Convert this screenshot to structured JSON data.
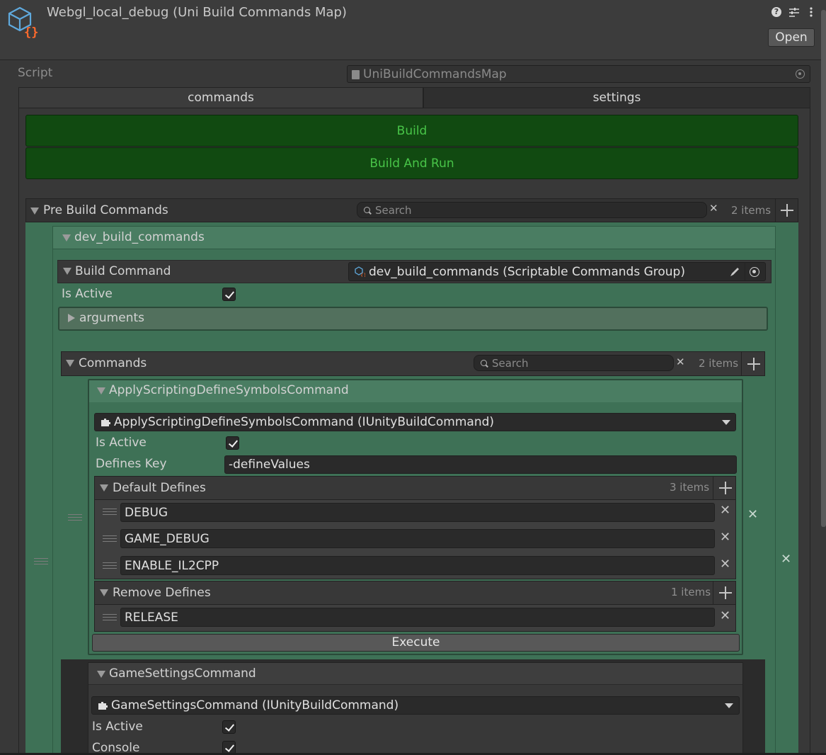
{
  "header": {
    "title": "Webgl_local_debug (Uni Build Commands Map)",
    "open_label": "Open",
    "help_icon": "question-circle-icon",
    "preset_icon": "sliders-icon",
    "menu_icon": "vertical-dots-icon"
  },
  "script_row": {
    "label": "Script",
    "value": "UniBuildCommandsMap"
  },
  "tabs": [
    {
      "label": "commands",
      "active": true
    },
    {
      "label": "settings",
      "active": false
    }
  ],
  "buttons": {
    "build": "Build",
    "build_and_run": "Build And Run"
  },
  "pre_build": {
    "label": "Pre Build Commands",
    "search_placeholder": "Search",
    "count": "2 items",
    "group": {
      "name": "dev_build_commands",
      "build_command_label": "Build Command",
      "build_command_value": "dev_build_commands (Scriptable Commands Group)",
      "is_active_label": "Is Active",
      "is_active": true,
      "arguments_label": "arguments",
      "commands": {
        "label": "Commands",
        "search_placeholder": "Search",
        "count": "2 items",
        "items": [
          {
            "name": "ApplyScriptingDefineSymbolsCommand",
            "type_value": "ApplyScriptingDefineSymbolsCommand (IUnityBuildCommand)",
            "is_active_label": "Is Active",
            "is_active": true,
            "defines_key_label": "Defines Key",
            "defines_key_value": "-defineValues",
            "default_defines": {
              "label": "Default Defines",
              "count": "3 items",
              "values": [
                "DEBUG",
                "GAME_DEBUG",
                "ENABLE_IL2CPP"
              ]
            },
            "remove_defines": {
              "label": "Remove Defines",
              "count": "1 items",
              "values": [
                "RELEASE"
              ]
            },
            "execute_label": "Execute"
          },
          {
            "name": "GameSettingsCommand",
            "type_value": "GameSettingsCommand (IUnityBuildCommand)",
            "is_active_label": "Is Active",
            "is_active": true,
            "console_label": "Console",
            "console": true
          }
        ]
      }
    }
  },
  "colors": {
    "background": "#383838",
    "green_panel": "#3e7156",
    "build_button": "#114a11",
    "build_text": "#48c448"
  }
}
